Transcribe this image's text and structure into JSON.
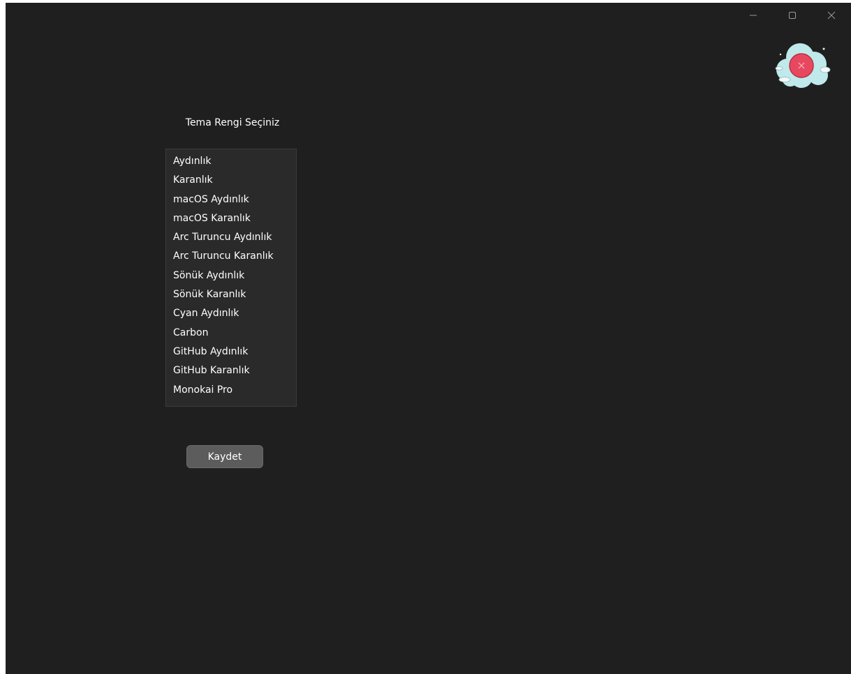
{
  "window": {
    "controls": {
      "minimize_icon": "minimize-icon",
      "maximize_icon": "maximize-icon",
      "close_icon": "close-icon"
    },
    "logo_icon": "cloud-logo-icon"
  },
  "theme_selector": {
    "prompt": "Tema Rengi Seçiniz",
    "options": [
      "Aydınlık",
      "Karanlık",
      "macOS Aydınlık",
      "macOS Karanlık",
      "Arc Turuncu Aydınlık",
      "Arc Turuncu Karanlık",
      "Sönük Aydınlık",
      "Sönük Karanlık",
      "Cyan Aydınlık",
      "Carbon",
      "GitHub Aydınlık",
      "GitHub Karanlık",
      "Monokai Pro"
    ]
  },
  "save_label": "Kaydet",
  "colors": {
    "background": "#1f1f1f",
    "list_background": "#2a2a2a",
    "button_background": "#5c5c5c",
    "logo_cloud": "#bfe9ea",
    "logo_accent": "#e8485f"
  }
}
